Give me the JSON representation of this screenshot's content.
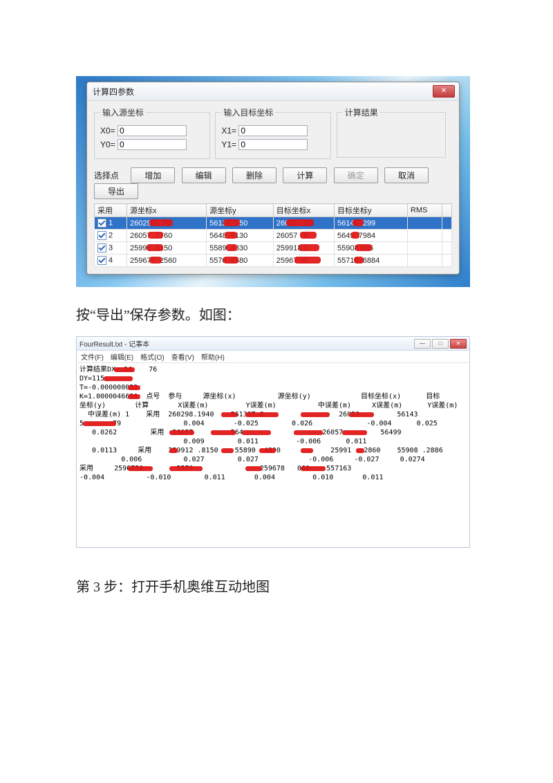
{
  "dialog": {
    "title": "计算四参数",
    "group_source": "输入源坐标",
    "group_target": "输入目标坐标",
    "group_result": "计算结果",
    "x0_label": "X0=",
    "y0_label": "Y0=",
    "x1_label": "X1=",
    "y1_label": "Y1=",
    "x0_value": "0",
    "y0_value": "0",
    "x1_value": "0",
    "y1_value": "0",
    "select_point": "选择点",
    "btn_add": "增加",
    "btn_edit": "编辑",
    "btn_delete": "删除",
    "btn_calc": "计算",
    "btn_ok": "确定",
    "btn_cancel": "取消",
    "btn_export": "导出",
    "table": {
      "headers": [
        "采用",
        "源坐标x",
        "源坐标y",
        "目标坐标x",
        "目标坐标y",
        "RMS",
        ""
      ],
      "rows": [
        {
          "n": "1",
          "sx": "26029█.███0",
          "sy": "5613█.6950",
          "tx": "260███.██20",
          "ty": "5614█.5299",
          "rms": ""
        },
        {
          "n": "2",
          "sx": "26057██.7760",
          "sy": "5648█.9130",
          "tx": "26057███70",
          "ty": "5649█.7984",
          "rms": ""
        },
        {
          "n": "3",
          "sx": "25991██.8150",
          "sy": "5589█.4330",
          "tx": "259918███0",
          "ty": "55908██886",
          "rms": ""
        },
        {
          "n": "4",
          "sx": "259675█.2560",
          "sy": "5570██.8580",
          "tx": "25967████30",
          "ty": "55716█.6884",
          "rms": ""
        }
      ]
    }
  },
  "prose1": "按“导出”保存参数。如图：",
  "notepad": {
    "title": "FourResult.txt - 记事本",
    "menu": [
      "文件(F)",
      "编辑(E)",
      "格式(O)",
      "查看(V)",
      "帮助(H)"
    ],
    "lines": [
      "计算结果DX=-14████76",
      "DY=115.██████",
      "T=-0.000000053██",
      "K=1.0000046630██点号  参与     源坐标(x)          源坐标(y)            目标坐标(x)      目标",
      "坐标(y)       计算       X误差(m)         Y误差(m)          中误差(m)     X误差(m)      Y误差(m)",
      "  中误差(m) 1    采用  260298.1940    561367.8███    ███████    26029██████   56143█████",
      "5███████79               0.004       -0.025        0.026             -0.004      0.025",
      "   0.0262        采用  26057█████    564█████    ██████    26057██████   56499█████",
      "                         0.009        0.011         -0.006      0.011",
      "   0.0113     采用    259912█.8150    55890██4890     ███    25991██.2860    55908█.2886",
      "          0.006          0.027        0.027            -0.006     -0.027     0.0274",
      "采用     2596750█████   5570███████         259678███060    557163█████",
      "-0.004          -0.010        0.011       0.004         0.010       0.011"
    ]
  },
  "prose2": "第 3 步：打开手机奥维互动地图"
}
